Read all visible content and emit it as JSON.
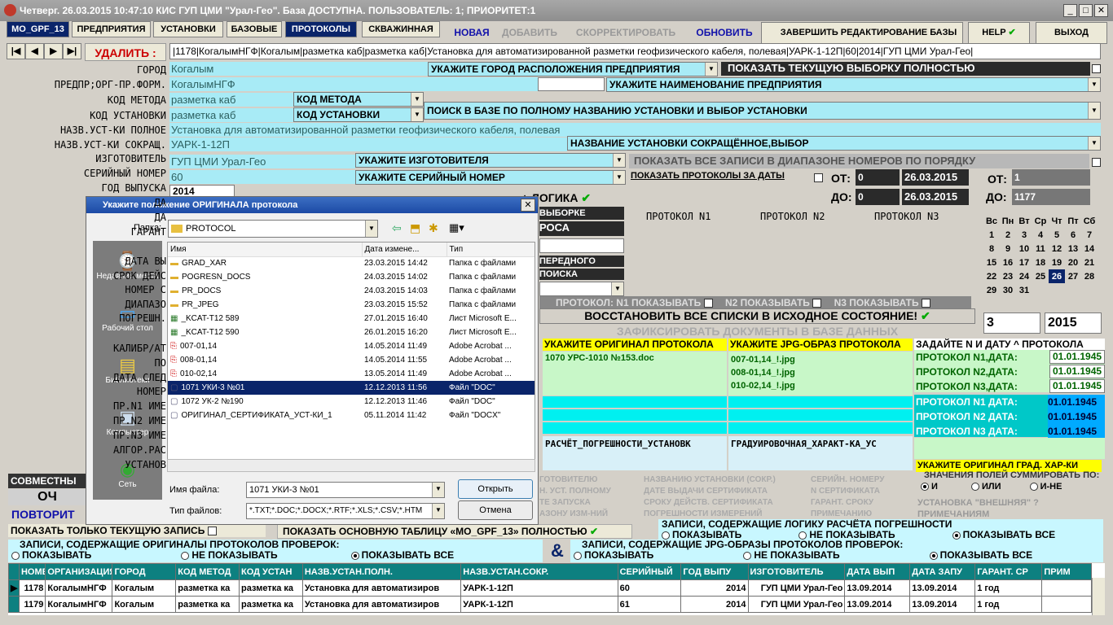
{
  "window": {
    "title": "Четверг. 26.03.2015 10:47:10 КИС ГУП ЦМИ \"Урал-Гео\". База ДОСТУПНА. ПОЛЬЗОВАТЕЛЬ: 1; ПРИОРИТЕТ:1"
  },
  "tabs": [
    "MO_GPF_13",
    "ПРЕДПРИЯТИЯ",
    "УСТАНОВКИ",
    "БАЗОВЫЕ",
    "ПРОТОКОЛЫ",
    "СКВАЖИННАЯ"
  ],
  "actions": {
    "new": "НОВАЯ",
    "add": "ДОБАВИТЬ",
    "correct": "СКОРРЕКТИРОВАТЬ",
    "refresh": "ОБНОВИТЬ",
    "finish": "ЗАВЕРШИТЬ РЕДАКТИРОВАНИЕ БАЗЫ",
    "help": "HELP",
    "exit": "ВЫХОД"
  },
  "nav": {
    "delete": "УДАЛИТЬ :",
    "record_line": "|1178|КогалымНГФ|Когалым|разметка каб|разметка каб|Установка для автоматизированной разметки геофизического кабеля, полевая|УАРК-1-12П|60|2014|ГУП ЦМИ Урал-Гео|"
  },
  "labels": {
    "city": "ГОРОД",
    "org": "ПРЕДПР;ОРГ-ПР.ФОРМ.",
    "method": "КОД МЕТОДА",
    "inst_code": "КОД УСТАНОВКИ",
    "full_name": "НАЗВ.УСТ-КИ ПОЛНОЕ",
    "short_name": "НАЗВ.УСТ-КИ СОКРАЩ.",
    "maker": "ИЗГОТОВИТЕЛЬ",
    "serial": "СЕРИЙНЫЙ НОМЕР",
    "year": "ГОД ВЫПУСКА",
    "da1": "ДА",
    "da2": "ДА",
    "garant": "ГАРАНТ",
    "data_vy": "ДАТА ВЫ",
    "srok": "СРОК ДЕЙС",
    "nomer": "НОМЕР С",
    "diapazon": "ДИАПАЗО",
    "pogresh": "ПОГРЕШН.",
    "kalibr": "КАЛИБР/АТ",
    "po": "ПО",
    "data_sled": "ДАТА СЛЕД",
    "nomer2": "НОМЕР",
    "pr1": "ПР.N1 ИМЕ",
    "pr2": "ПР.N2 ИМЕ",
    "pr3": "ПР.N3 ИМЕ",
    "algor": "АЛГОР.РАС",
    "ustanov": "УСТАНОВ"
  },
  "fields": {
    "city": "Когалым",
    "city_combo": "УКАЖИТЕ ГОРОД РАСПОЛОЖЕНИЯ ПРЕДПРИЯТИЯ",
    "show_all": "ПОКАЗАТЬ ТЕКУЩУЮ ВЫБОРКУ ПОЛНОСТЬЮ",
    "org": "КогалымНГФ",
    "org_combo": "УКАЖИТЕ НАИМЕНОВАНИЕ ПРЕДПРИЯТИЯ",
    "method": "разметка каб",
    "method_combo": "КОД МЕТОДА",
    "inst_code": "разметка каб",
    "inst_combo": "КОД УСТАНОВКИ",
    "search": "ПОИСК В БАЗЕ ПО ПОЛНОМУ НАЗВАНИЮ УСТАНОВКИ И ВЫБОР УСТАНОВКИ",
    "full_name": "Установка для автоматизированной разметки геофизического кабеля, полевая",
    "short_name": "УАРК-1-12П",
    "short_combo": "НАЗВАНИЕ УСТАНОВКИ СОКРАЩЁННОЕ,ВЫБОР",
    "maker": "ГУП ЦМИ Урал-Гео",
    "maker_combo": "УКАЖИТЕ ИЗГОТОВИТЕЛЯ",
    "serial": "60",
    "serial_combo": "УКАЖИТЕ СЕРИЙНЫЙ НОМЕР",
    "year": "2014"
  },
  "range": {
    "show_range": "ПОКАЗАТЬ ВСЕ ЗАПИСИ В ДИАПАЗОНЕ НОМЕРОВ ПО ПОРЯДКУ",
    "show_dates": "ПОКАЗАТЬ ПРОТОКОЛЫ ЗА ДАТЫ",
    "from": "ОТ:",
    "to": "ДО:",
    "from_val": "0",
    "to_val": "0",
    "date_from": "26.03.2015",
    "date_to": "26.03.2015",
    "from2": "ОТ:",
    "to2": "ДО:",
    "from2_val": "1",
    "to2_val": "1177"
  },
  "logic": {
    "logic": "+ ЛОГИКА",
    "vyborke": "ВЫБОРКЕ",
    "prosa": "РОСА",
    "peredn": "ПЕРЕДНОГО",
    "poiska": "ПОИСКА"
  },
  "protocols": {
    "p1": "ПРОТОКОЛ N1",
    "p2": "ПРОТОКОЛ N2",
    "p3": "ПРОТОКОЛ N3",
    "show1": "ПРОТОКОЛ:  N1  ПОКАЗЫВАТЬ",
    "show2": "N2 ПОКАЗЫВАТЬ",
    "show3": "N3  ПОКАЗЫВАТЬ",
    "restore": "ВОССТАНОВИТЬ ВСЕ СПИСКИ В ИСХОДНОЕ СОСТОЯНИЕ!",
    "fix": "ЗАФИКСИРОВАТЬ ДОКУМЕНТЫ В БАЗЕ ДАННЫХ"
  },
  "calendar": {
    "days": [
      "Вс",
      "Пн",
      "Вт",
      "Ср",
      "Чт",
      "Пт",
      "Сб"
    ],
    "rows": [
      [
        "1",
        "2",
        "3",
        "4",
        "5",
        "6",
        "7"
      ],
      [
        "8",
        "9",
        "10",
        "11",
        "12",
        "13",
        "14"
      ],
      [
        "15",
        "16",
        "17",
        "18",
        "19",
        "20",
        "21"
      ],
      [
        "22",
        "23",
        "24",
        "25",
        "26",
        "27",
        "28"
      ],
      [
        "29",
        "30",
        "31",
        "",
        "",
        "",
        ""
      ]
    ],
    "month": "3",
    "year": "2015",
    "selected": "26"
  },
  "docs": {
    "orig_hdr": "УКАЖИТЕ ОРИГИНАЛ ПРОТОКОЛА",
    "jpg_hdr": "УКАЖИТЕ JPG-ОБРАЗ ПРОТОКОЛА",
    "date_hdr": "ЗАДАЙТЕ N И ДАТУ ^ ПРОТОКОЛА",
    "orig_file": "1070 УРС-1010 №153.doc",
    "jpg1": "007-01,14_!.jpg",
    "jpg2": "008-01,14_!.jpg",
    "jpg3": "010-02,14_!.jpg",
    "pn1": "ПРОТОКОЛ N1,ДАТА:",
    "pn2": "ПРОТОКОЛ N2,ДАТА:",
    "pn3": "ПРОТОКОЛ N3,ДАТА:",
    "pd1": "01.01.1945",
    "pd2": "01.01.1945",
    "pd3": "01.01.1945",
    "pc1": "ПРОТОКОЛ N1 ДАТА:",
    "pc2": "ПРОТОКОЛ N2 ДАТА:",
    "pc3": "ПРОТОКОЛ N3 ДАТА:",
    "pcd1": "01.01.1945",
    "pcd2": "01.01.1945",
    "pcd3": "01.01.1945",
    "calc": "РАСЧЁТ_ПОГРЕШНОСТИ_УСТАНОВК",
    "grad": "ГРАДУИРОВОЧНАЯ_ХАРАКТ-КА_УС",
    "orig_grad": "УКАЖИТЕ ОРИГИНАЛ ГРАД. ХАР-КИ",
    "sum": "ЗНАЧЕНИЯ ПОЛЕЙ СУММИРОВАТЬ ПО:",
    "and": "И",
    "or": "ИЛИ",
    "and_not": "И-НЕ",
    "ext": "УСТАНОВКА \"ВНЕШНЯЯ\" ?",
    "notes": "ПРИМЕЧАНИЯМ"
  },
  "filters": {
    "f1": "ГОТОВИТЕЛЮ",
    "f2": "Н. УСТ. ПОЛНОМУ",
    "f3": "ТЕ ЗАПУСКА",
    "f4": "АЗОНУ ИЗМ-НИЙ",
    "g1": "НАЗВАНИЮ УСТАНОВКИ (СОКР.)",
    "g2": "ДАТЕ ВЫДАЧИ СЕРТИФИКАТА",
    "g3": "СРОКУ ДЕЙСТВ. СЕРТИФИКАТА",
    "g4": "ПОГРЕШНОСТИ ИЗМЕРЕНИЙ",
    "h1": "СЕРИЙН. НОМЕРУ",
    "h2": "N СЕРТИФИКАТА",
    "h3": "ГАРАНТ. СРОКУ",
    "h4": "ПРИМЕЧАНИЮ"
  },
  "bottom": {
    "joint": "СОВМЕСТНЫ",
    "och": "ОЧ",
    "repeat": "ПОВТОРИТ",
    "only_current": "ПОКАЗАТЬ ТОЛЬКО ТЕКУЩУЮ ЗАПИСЬ",
    "show_main": "ПОКАЗАТЬ ОСНОВНУЮ ТАБЛИЦУ «MO_GPF_13» ПОЛНОСТЬЮ",
    "logic_title": "ЗАПИСИ, СОДЕРЖАЩИЕ ЛОГИКУ  РАСЧЁТА ПОГРЕШНОСТИ",
    "show": "ПОКАЗЫВАТЬ",
    "not_show": "НЕ ПОКАЗЫВАТЬ",
    "show_all": "ПОКАЗЫВАТЬ ВСЕ",
    "orig_title": "ЗАПИСИ, СОДЕРЖАЩИЕ ОРИГИНАЛЫ ПРОТОКОЛОВ ПРОВЕРОК:",
    "jpg_title": "ЗАПИСИ, СОДЕРЖАЩИЕ JPG-ОБРАЗЫ ПРОТОКОЛОВ ПРОВЕРОК:",
    "amp": "&"
  },
  "table": {
    "columns": [
      "НОМЕ",
      "ОРГАНИЗАЦИЯ",
      "ГОРОД",
      "КОД МЕТОД",
      "КОД УСТАН",
      "НАЗВ.УСТАН.ПОЛН.",
      "НАЗВ.УСТАН.СОКР.",
      "СЕРИЙНЫЙ",
      "ГОД ВЫПУ",
      "ИЗГОТОВИТЕЛЬ",
      "ДАТА ВЫП",
      "ДАТА ЗАПУ",
      "ГАРАНТ. СР",
      "ПРИМ"
    ],
    "rows": [
      [
        "1178",
        "КогалымНГФ",
        "Когалым",
        "разметка ка",
        "разметка ка",
        "Установка для автоматизиров",
        "УАРК-1-12П",
        "60",
        "2014",
        "ГУП ЦМИ Урал-Гео",
        "13.09.2014",
        "13.09.2014",
        "1 год",
        ""
      ],
      [
        "1179",
        "КогалымНГФ",
        "Когалым",
        "разметка ка",
        "разметка ка",
        "Установка для автоматизиров",
        "УАРК-1-12П",
        "61",
        "2014",
        "ГУП ЦМИ Урал-Гео",
        "13.09.2014",
        "13.09.2014",
        "1 год",
        ""
      ]
    ]
  },
  "dialog": {
    "title": "Укажите положение ОРИГИНАЛА протокола",
    "folder_label": "Папка:",
    "folder": "PROTOCOL",
    "places": [
      "Недавние места",
      "Рабочий стол",
      "Библиотеки",
      "Компьютер",
      "Сеть"
    ],
    "cols": [
      "Имя",
      "Дата измене...",
      "Тип"
    ],
    "files": [
      [
        "GRAD_XAR",
        "23.03.2015 14:42",
        "Папка с файлами",
        "folder"
      ],
      [
        "POGRESN_DOCS",
        "24.03.2015 14:02",
        "Папка с файлами",
        "folder"
      ],
      [
        "PR_DOCS",
        "24.03.2015 14:03",
        "Папка с файлами",
        "folder"
      ],
      [
        "PR_JPEG",
        "23.03.2015 15:52",
        "Папка с файлами",
        "folder"
      ],
      [
        "_KCAT-T12 589",
        "27.01.2015 16:40",
        "Лист Microsoft E...",
        "xls"
      ],
      [
        "_KCAT-T12 590",
        "26.01.2015 16:20",
        "Лист Microsoft E...",
        "xls"
      ],
      [
        "007-01,14",
        "14.05.2014 11:49",
        "Adobe Acrobat ...",
        "pdf"
      ],
      [
        "008-01,14",
        "14.05.2014 11:55",
        "Adobe Acrobat ...",
        "pdf"
      ],
      [
        "010-02,14",
        "13.05.2014 11:49",
        "Adobe Acrobat ...",
        "pdf"
      ],
      [
        "1071 УКИ-3 №01",
        "12.12.2013 11:56",
        "Файл \"DOC\"",
        "doc"
      ],
      [
        "1072 УК-2 №190",
        "12.12.2013 11:46",
        "Файл \"DOC\"",
        "doc"
      ],
      [
        "ОРИГИНАЛ_СЕРТИФИКАТА_УСТ-КИ_1",
        "05.11.2014 11:42",
        "Файл \"DOCX\"",
        "doc"
      ]
    ],
    "selected_index": 9,
    "filename_label": "Имя файла:",
    "filename": "1071 УКИ-3 №01",
    "filetype_label": "Тип файлов:",
    "filetype": "*.TXT;*.DOC;*.DOCX;*.RTF;*.XLS;*.CSV;*.HTM",
    "open": "Открыть",
    "cancel": "Отмена"
  },
  "colors": {
    "accent": "#0a246a",
    "cyan": "#a8ebf6",
    "teal": "#0d8080",
    "yellow": "#ffff00"
  }
}
